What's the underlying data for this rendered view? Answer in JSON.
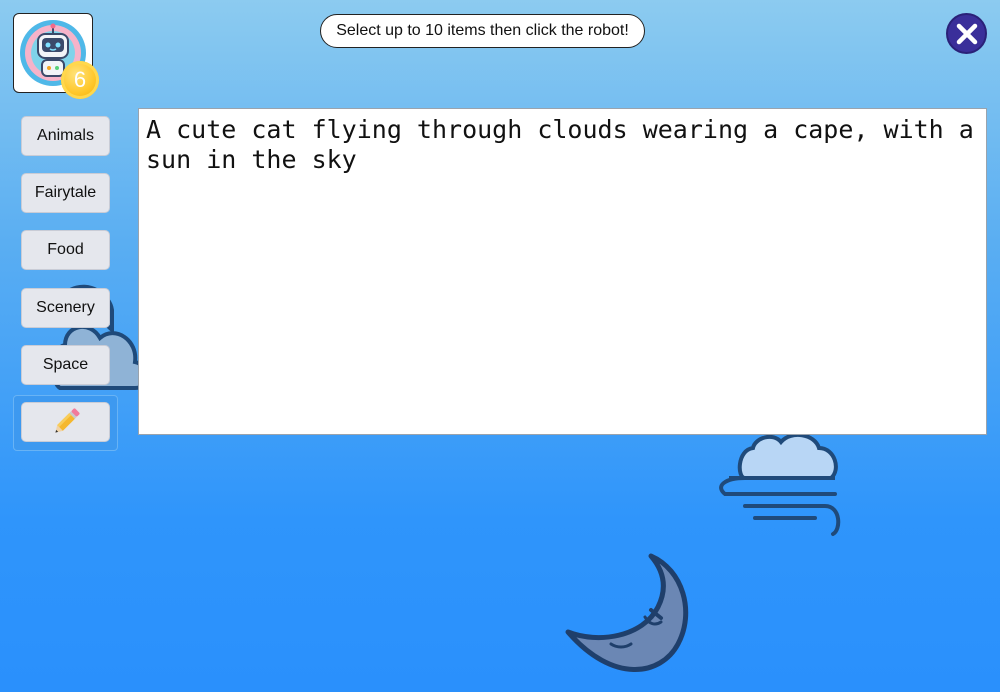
{
  "header": {
    "instruction": "Select up to 10 items then click the robot!",
    "coin_count": "6",
    "icons": {
      "robot": "robot-avatar-icon",
      "close": "close-x-icon",
      "coin": "coin-badge"
    }
  },
  "sidebar": {
    "categories": [
      {
        "label": "Animals"
      },
      {
        "label": "Fairytale"
      },
      {
        "label": "Food"
      },
      {
        "label": "Scenery"
      },
      {
        "label": "Space"
      }
    ],
    "custom_icon": "pencil-icon"
  },
  "editor": {
    "text": "A cute cat flying through clouds wearing a cape, with a sun in the sky"
  },
  "decorations": [
    "cloud-icon",
    "windy-cloud-icon",
    "moon-icon"
  ],
  "colors": {
    "close_button": "#3a2f9a",
    "coin": "#ffc72a",
    "sky_top": "#8ccbf0",
    "sky_bottom": "#2a90fc"
  }
}
